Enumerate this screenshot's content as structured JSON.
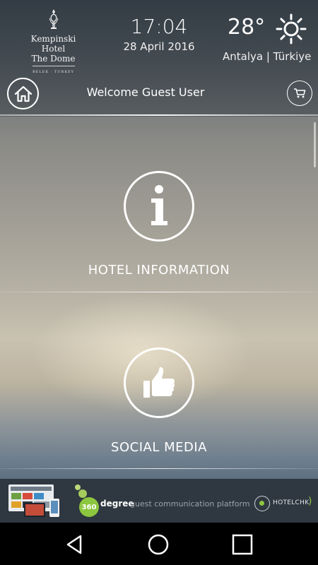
{
  "header": {
    "logo": {
      "line1": "Kempinski Hotel",
      "line2": "The Dome",
      "sub": "BELEK · TURKEY"
    },
    "time": "17:04",
    "date": "28 April 2016",
    "weather": {
      "temperature": "28°",
      "icon": "sun-icon",
      "city": "Antalya | Türkiye"
    },
    "home_icon": "home-icon",
    "cart_icon": "cart-icon",
    "welcome": "Welcome Guest User"
  },
  "menu": {
    "items": [
      {
        "label": "HOTEL INFORMATION",
        "icon": "info-icon"
      },
      {
        "label": "SOCIAL MEDIA",
        "icon": "thumbs-up-icon"
      }
    ]
  },
  "banner": {
    "badge": "360",
    "degree": "degree",
    "text": "guest communication platform",
    "brand": "HOTELCHK",
    "accent_color": "#8cc63f"
  },
  "navbar": {
    "back_icon": "back-icon",
    "home_icon": "home-circle-icon",
    "recents_icon": "recents-icon"
  }
}
